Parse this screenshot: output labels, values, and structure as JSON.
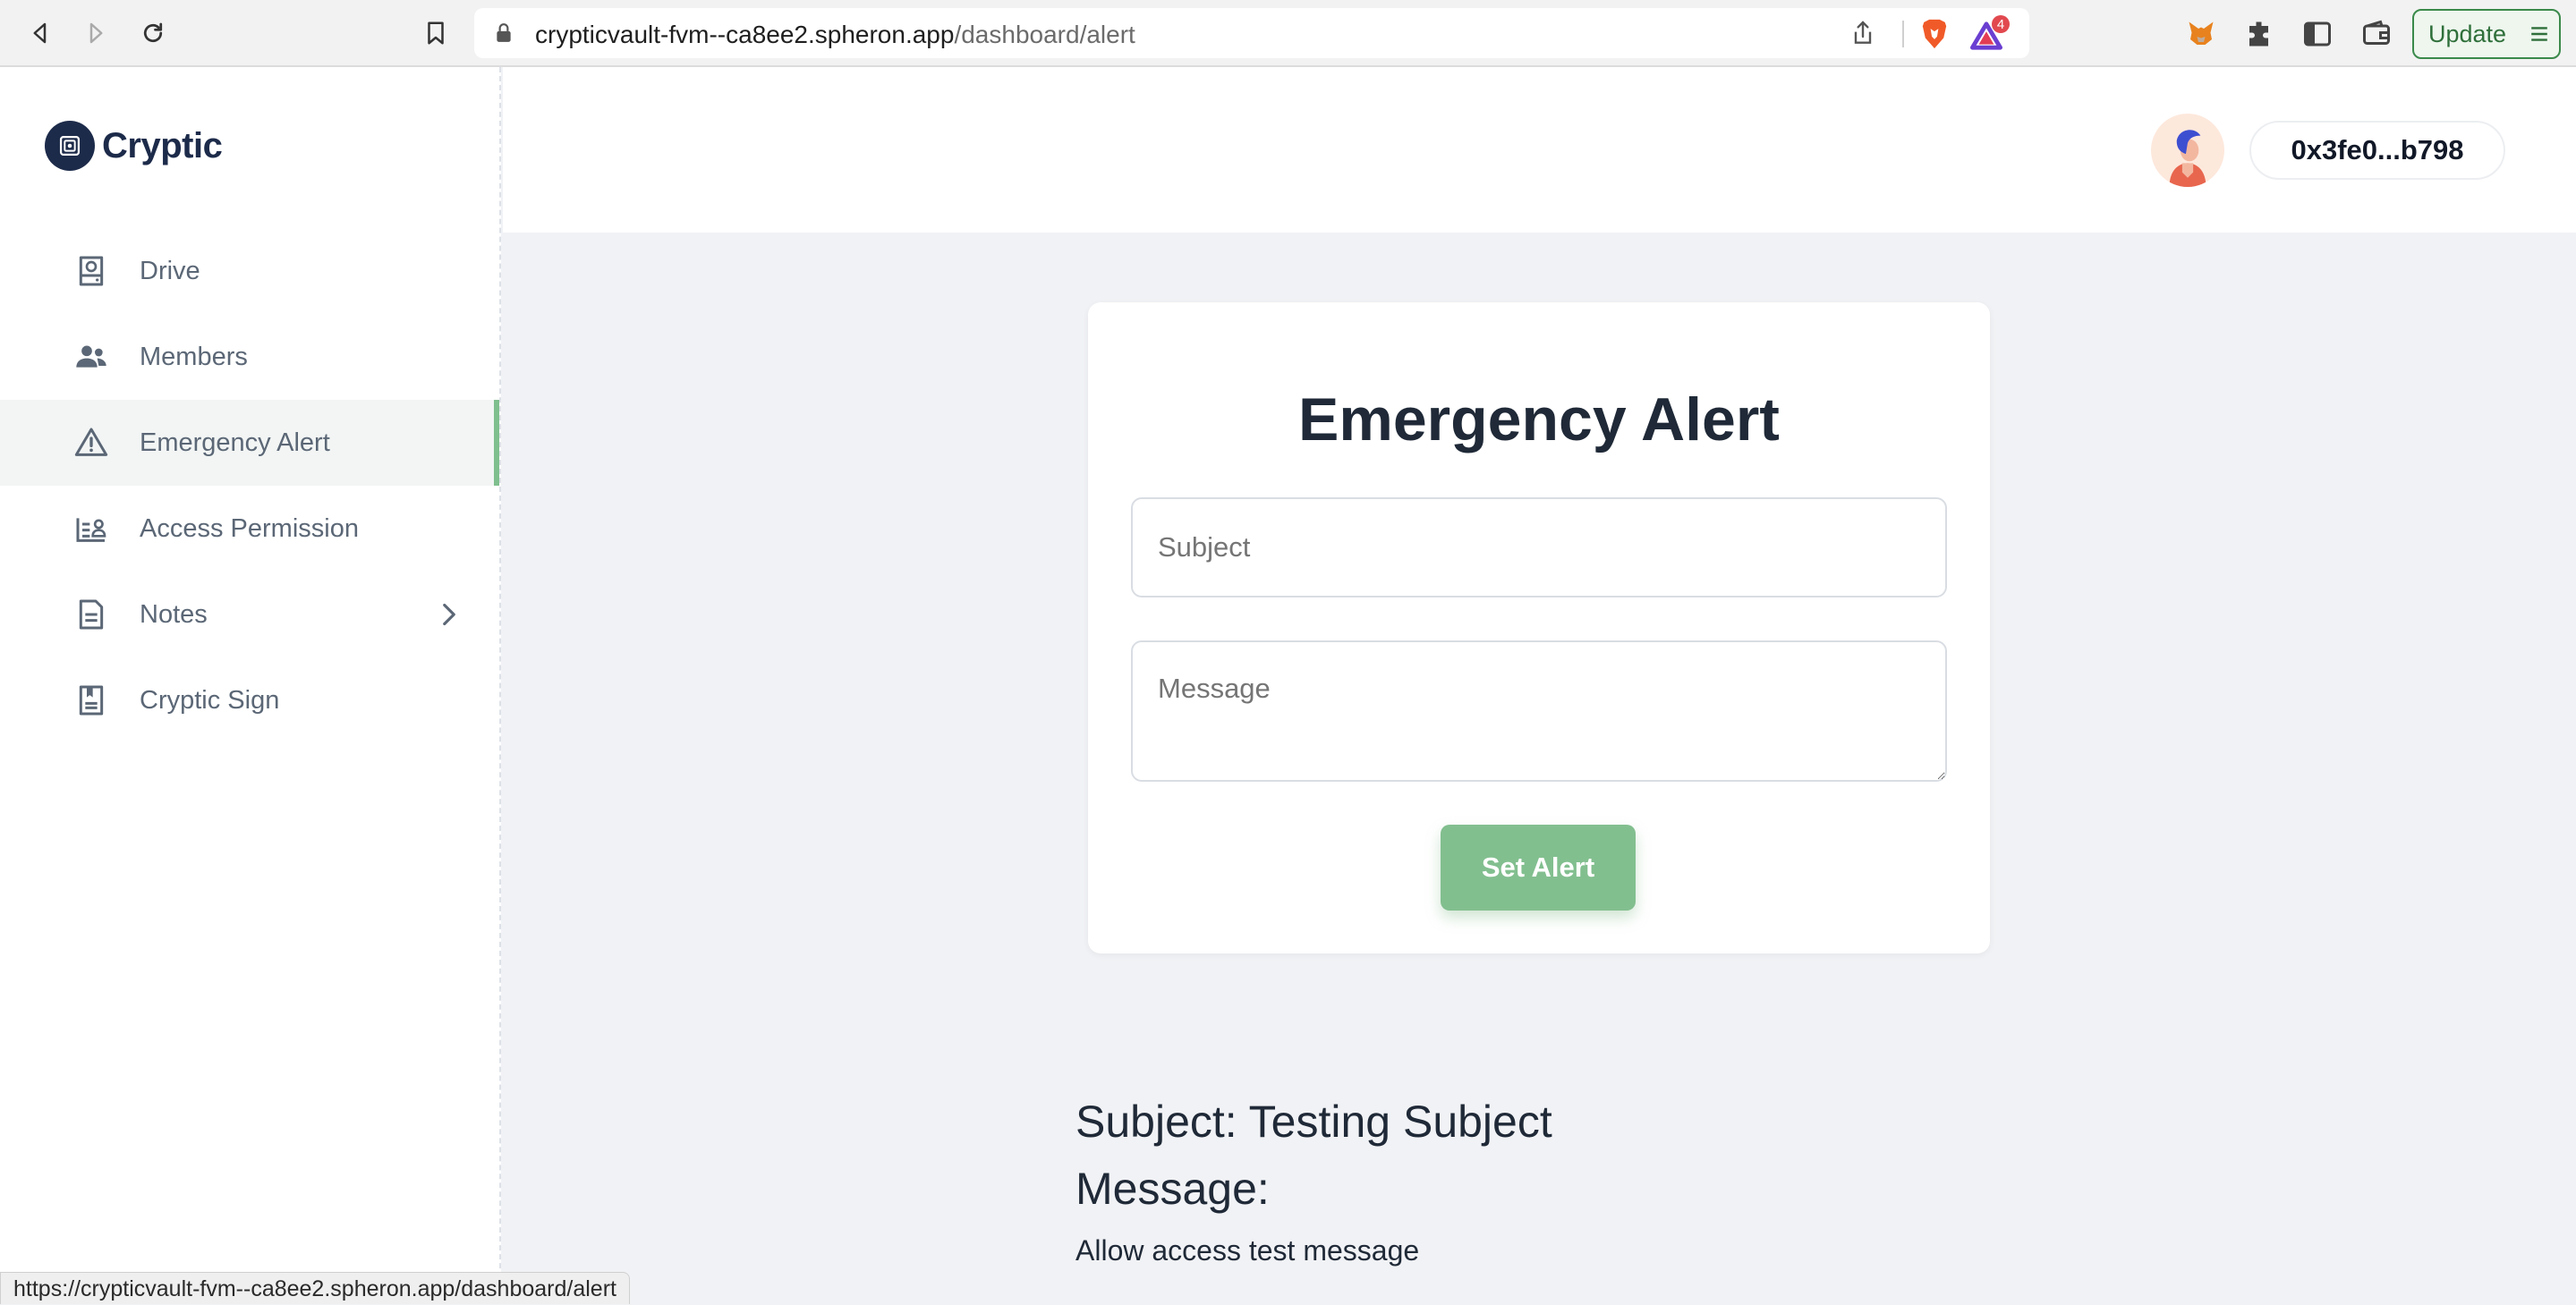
{
  "browser": {
    "url_host": "crypticvault-fvm--ca8ee2.spheron.app",
    "url_path": "/dashboard/alert",
    "rewards_badge": "4",
    "update_label": "Update",
    "status_url": "https://crypticvault-fvm--ca8ee2.spheron.app/dashboard/alert"
  },
  "app": {
    "logo_text": "Cryptic"
  },
  "sidebar": {
    "items": [
      {
        "label": "Drive",
        "icon": "drive-icon"
      },
      {
        "label": "Members",
        "icon": "users-icon"
      },
      {
        "label": "Emergency Alert",
        "icon": "warning-icon",
        "active": true
      },
      {
        "label": "Access Permission",
        "icon": "id-card-icon"
      },
      {
        "label": "Notes",
        "icon": "document-icon"
      },
      {
        "label": "Cryptic Sign",
        "icon": "book-icon"
      }
    ]
  },
  "header": {
    "wallet_address": "0x3fe0...b798"
  },
  "alert_form": {
    "title": "Emergency Alert",
    "subject_placeholder": "Subject",
    "message_placeholder": "Message",
    "submit_label": "Set Alert"
  },
  "current_alert": {
    "subject_line": "Subject: Testing Subject",
    "message_label": "Message:",
    "message_text": "Allow access test message"
  },
  "colors": {
    "accent": "#82bf8f",
    "active_bar": "#7fbf8e",
    "logo": "#1d2b4a",
    "page_bg": "#f1f2f5"
  }
}
